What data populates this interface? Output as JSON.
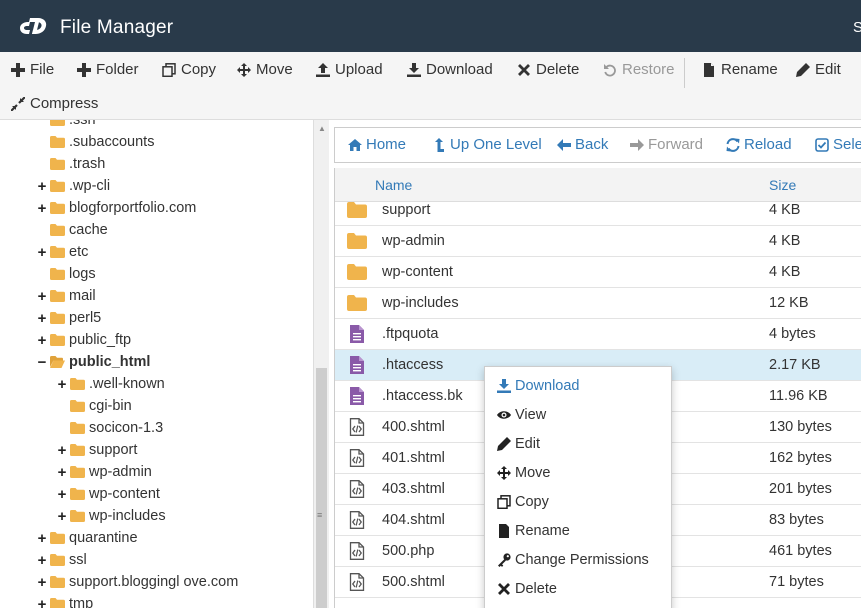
{
  "app": {
    "title": "File Manager",
    "user_initial": "S",
    "colors": {
      "header_bg": "#293a4a",
      "link": "#337ab7",
      "folder": "#f0b44c",
      "doc": "#8a5aa8",
      "selected_row": "#d9edf7"
    }
  },
  "toolbar": {
    "file": "File",
    "folder": "Folder",
    "copy": "Copy",
    "move": "Move",
    "upload": "Upload",
    "download": "Download",
    "delete": "Delete",
    "restore": "Restore",
    "rename": "Rename",
    "edit": "Edit",
    "compress": "Compress"
  },
  "tree": [
    {
      "label": ".ssh",
      "toggle": ""
    },
    {
      "label": ".subaccounts",
      "toggle": ""
    },
    {
      "label": ".trash",
      "toggle": ""
    },
    {
      "label": ".wp-cli",
      "toggle": "+"
    },
    {
      "label": "blogforportfolio.com",
      "toggle": "+"
    },
    {
      "label": "cache",
      "toggle": ""
    },
    {
      "label": "etc",
      "toggle": "+"
    },
    {
      "label": "logs",
      "toggle": ""
    },
    {
      "label": "mail",
      "toggle": "+"
    },
    {
      "label": "perl5",
      "toggle": "+"
    },
    {
      "label": "public_ftp",
      "toggle": "+"
    },
    {
      "label": "public_html",
      "toggle": "−"
    },
    {
      "label": ".well-known",
      "toggle": "+"
    },
    {
      "label": "cgi-bin",
      "toggle": ""
    },
    {
      "label": "socicon-1.3",
      "toggle": ""
    },
    {
      "label": "support",
      "toggle": "+"
    },
    {
      "label": "wp-admin",
      "toggle": "+"
    },
    {
      "label": "wp-content",
      "toggle": "+"
    },
    {
      "label": "wp-includes",
      "toggle": "+"
    },
    {
      "label": "quarantine",
      "toggle": "+"
    },
    {
      "label": "ssl",
      "toggle": "+"
    },
    {
      "label": "support.bloggingl ove.com",
      "toggle": "+"
    },
    {
      "label": "tmp",
      "toggle": "+"
    }
  ],
  "nav": {
    "home": "Home",
    "up": "Up One Level",
    "back": "Back",
    "forward": "Forward",
    "reload": "Reload",
    "select": "Selec"
  },
  "table": {
    "headers": {
      "name": "Name",
      "size": "Size"
    },
    "rows": [
      {
        "name": "support",
        "size": "4 KB",
        "type": "folder"
      },
      {
        "name": "wp-admin",
        "size": "4 KB",
        "type": "folder"
      },
      {
        "name": "wp-content",
        "size": "4 KB",
        "type": "folder"
      },
      {
        "name": "wp-includes",
        "size": "12 KB",
        "type": "folder"
      },
      {
        "name": ".ftpquota",
        "size": "4 bytes",
        "type": "doc"
      },
      {
        "name": ".htaccess",
        "size": "2.17 KB",
        "type": "doc"
      },
      {
        "name": ".htaccess.bk",
        "size": "11.96 KB",
        "type": "doc"
      },
      {
        "name": "400.shtml",
        "size": "130 bytes",
        "type": "code"
      },
      {
        "name": "401.shtml",
        "size": "162 bytes",
        "type": "code"
      },
      {
        "name": "403.shtml",
        "size": "201 bytes",
        "type": "code"
      },
      {
        "name": "404.shtml",
        "size": "83 bytes",
        "type": "code"
      },
      {
        "name": "500.php",
        "size": "461 bytes",
        "type": "code"
      },
      {
        "name": "500.shtml",
        "size": "71 bytes",
        "type": "code"
      }
    ]
  },
  "context_menu": {
    "download": "Download",
    "view": "View",
    "edit": "Edit",
    "move": "Move",
    "copy": "Copy",
    "rename": "Rename",
    "change_permissions": "Change Permissions",
    "delete": "Delete"
  }
}
